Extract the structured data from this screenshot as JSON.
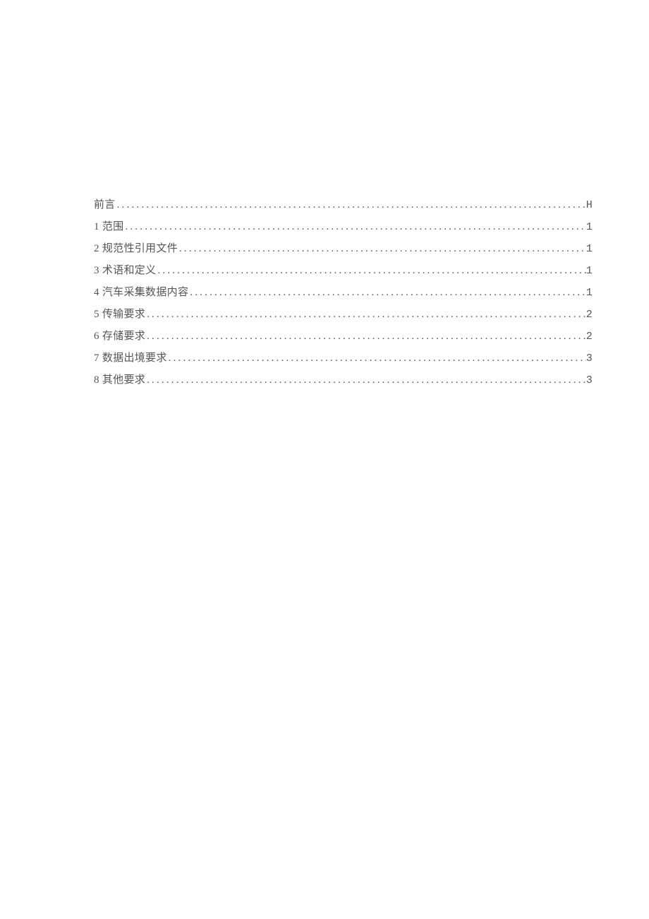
{
  "toc": {
    "entries": [
      {
        "label": "前言",
        "page": "H"
      },
      {
        "label": "1 范围",
        "page": "1"
      },
      {
        "label": "2 规范性引用文件",
        "page": "1"
      },
      {
        "label": "3 术语和定义",
        "page": "1"
      },
      {
        "label": "4 汽车采集数据内容",
        "page": "1"
      },
      {
        "label": "5 传输要求",
        "page": "2"
      },
      {
        "label": "6 存储要求",
        "page": "2"
      },
      {
        "label": "7 数据出境要求",
        "page": "3"
      },
      {
        "label": "8 其他要求",
        "page": "3"
      }
    ]
  }
}
